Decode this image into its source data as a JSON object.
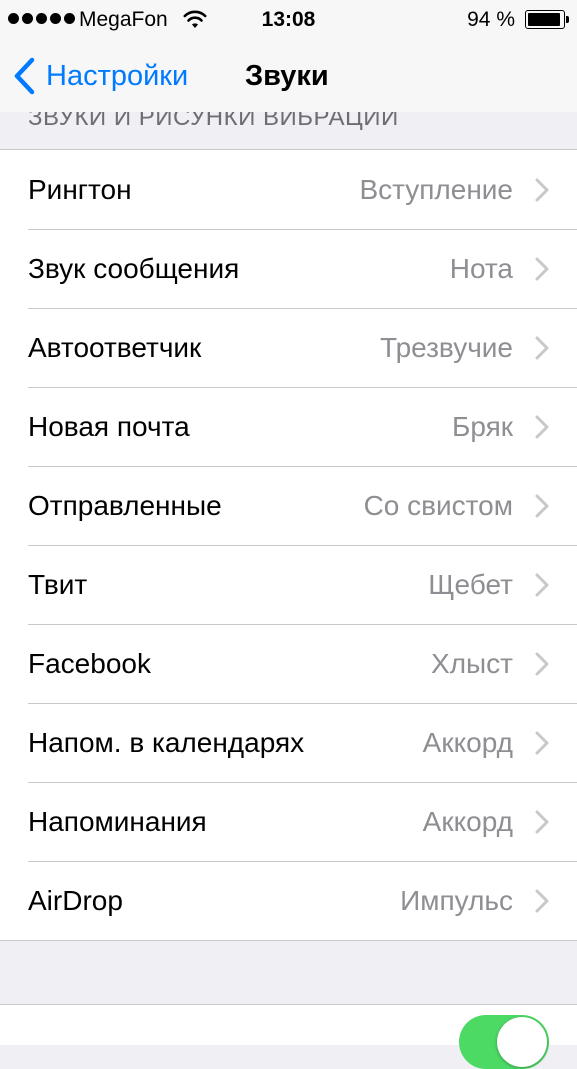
{
  "status_bar": {
    "carrier": "MegaFon",
    "time": "13:08",
    "battery_percent": "94 %",
    "battery_level": 0.94,
    "signal_bars": 5,
    "wifi_icon": "wifi-icon",
    "battery_icon": "battery-icon"
  },
  "nav": {
    "back_label": "Настройки",
    "back_icon": "chevron-left-icon",
    "title": "Звуки"
  },
  "section": {
    "header": "ЗВУКИ И РИСУНКИ ВИБРАЦИИ",
    "rows": [
      {
        "label": "Рингтон",
        "value": "Вступление"
      },
      {
        "label": "Звук сообщения",
        "value": "Нота"
      },
      {
        "label": "Автоответчик",
        "value": "Трезвучие"
      },
      {
        "label": "Новая почта",
        "value": "Бряк"
      },
      {
        "label": "Отправленные",
        "value": "Со свистом"
      },
      {
        "label": "Твит",
        "value": "Щебет"
      },
      {
        "label": "Facebook",
        "value": "Хлыст"
      },
      {
        "label": "Напом. в календарях",
        "value": "Аккорд"
      },
      {
        "label": "Напоминания",
        "value": "Аккорд"
      },
      {
        "label": "AirDrop",
        "value": "Импульс"
      }
    ]
  },
  "toggle": {
    "on": true
  },
  "colors": {
    "accent": "#007aff",
    "toggle_on": "#4cd964",
    "secondary_text": "#8e8e93",
    "background": "#efeff4"
  }
}
